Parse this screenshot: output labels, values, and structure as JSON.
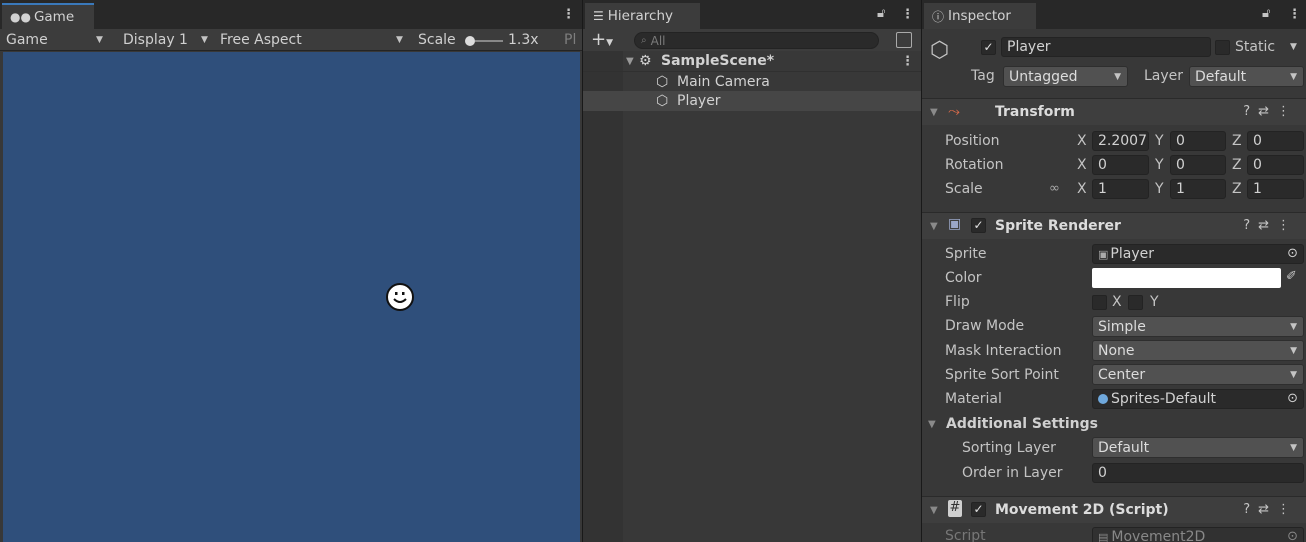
{
  "game": {
    "tab_label": "Game",
    "mode": "Game",
    "display": "Display 1",
    "aspect": "Free Aspect",
    "scale_label": "Scale",
    "scale_value": "1.3x",
    "truncated": "Pl",
    "bg_color": "#2f4f7b"
  },
  "hierarchy": {
    "tab_label": "Hierarchy",
    "add_label": "+",
    "search_placeholder": "All",
    "scene": "SampleScene*",
    "items": [
      "Main Camera",
      "Player"
    ],
    "selected": "Player"
  },
  "inspector": {
    "tab_label": "Inspector",
    "object_name": "Player",
    "active_checked": true,
    "static_label": "Static",
    "tag_label": "Tag",
    "tag_value": "Untagged",
    "layer_label": "Layer",
    "layer_value": "Default",
    "transform": {
      "title": "Transform",
      "position_label": "Position",
      "rotation_label": "Rotation",
      "scale_label": "Scale",
      "position": {
        "x": "2.2007",
        "y": "0",
        "z": "0"
      },
      "rotation": {
        "x": "0",
        "y": "0",
        "z": "0"
      },
      "scale": {
        "x": "1",
        "y": "1",
        "z": "1"
      },
      "axis_x": "X",
      "axis_y": "Y",
      "axis_z": "Z"
    },
    "sprite_renderer": {
      "title": "Sprite Renderer",
      "sprite_label": "Sprite",
      "sprite_value": "Player",
      "color_label": "Color",
      "color_value": "#ffffff",
      "flip_label": "Flip",
      "flip_x": "X",
      "flip_y": "Y",
      "draw_mode_label": "Draw Mode",
      "draw_mode_value": "Simple",
      "mask_label": "Mask Interaction",
      "mask_value": "None",
      "sort_point_label": "Sprite Sort Point",
      "sort_point_value": "Center",
      "material_label": "Material",
      "material_value": "Sprites-Default",
      "additional_label": "Additional Settings",
      "sorting_layer_label": "Sorting Layer",
      "sorting_layer_value": "Default",
      "order_label": "Order in Layer",
      "order_value": "0"
    },
    "movement": {
      "title": "Movement 2D (Script)",
      "script_label": "Script",
      "script_value": "Movement2D"
    }
  }
}
